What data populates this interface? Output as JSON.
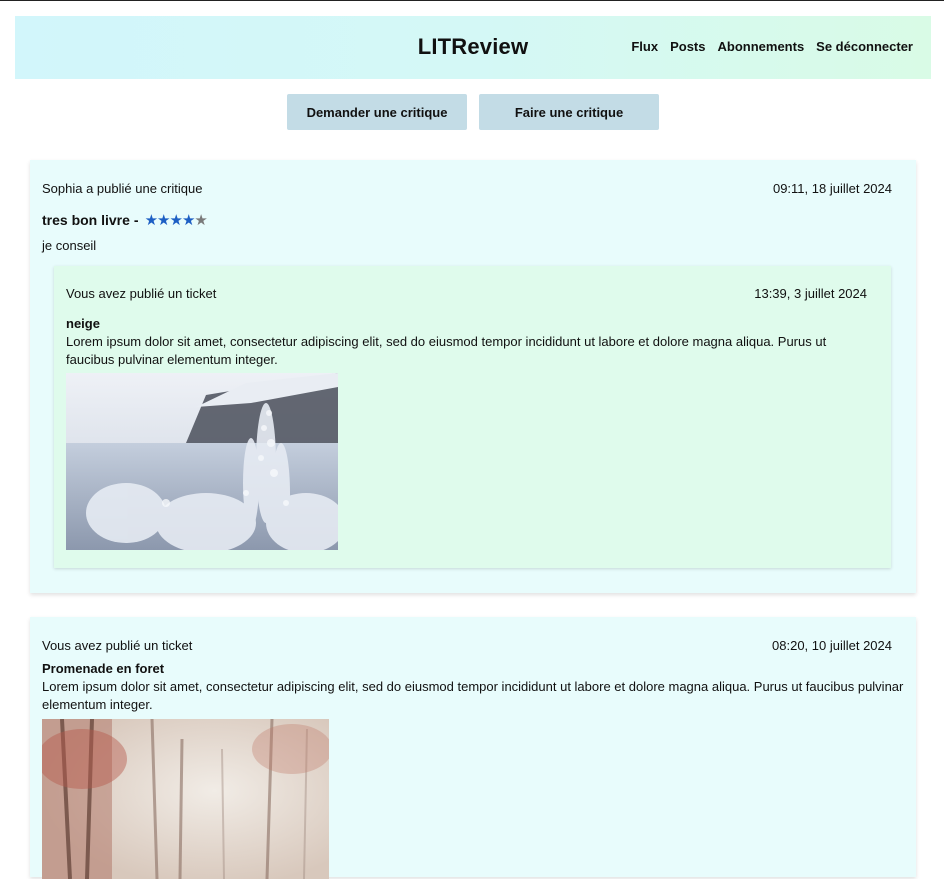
{
  "header": {
    "brand": "LITReview",
    "nav": [
      "Flux",
      "Posts",
      "Abonnements",
      "Se déconnecter"
    ]
  },
  "actions": {
    "request_label": "Demander une critique",
    "review_label": "Faire une critique"
  },
  "feed": {
    "review": {
      "author_line": "Sophia a publié une critique",
      "timestamp": "09:11, 18 juillet 2024",
      "headline": "tres bon livre",
      "separator": "-",
      "rating": 4,
      "rating_max": 5,
      "body": "je conseil",
      "ticket": {
        "author_line": "Vous avez publié un ticket",
        "timestamp": "13:39, 3 juillet 2024",
        "title": "neige",
        "description": "Lorem ipsum dolor sit amet, consectetur adipiscing elit, sed do eiusmod tempor incididunt ut labore et dolore magna aliqua. Purus ut faucibus pulvinar elementum integer.",
        "image": "snowy-plants-photo"
      }
    },
    "ticket": {
      "author_line": "Vous avez publié un ticket",
      "timestamp": "08:20, 10 juillet 2024",
      "title": "Promenade en foret",
      "description": "Lorem ipsum dolor sit amet, consectetur adipiscing elit, sed do eiusmod tempor incididunt ut labore et dolore magna aliqua. Purus ut faucibus pulvinar elementum integer.",
      "image": "misty-forest-photo"
    }
  },
  "colors": {
    "button_bg": "#c3dce6",
    "card_bg": "#e8fcfc",
    "inner_card_bg": "#dffbec",
    "star_on": "#1d5fc4",
    "star_off": "#7a7a7a"
  }
}
